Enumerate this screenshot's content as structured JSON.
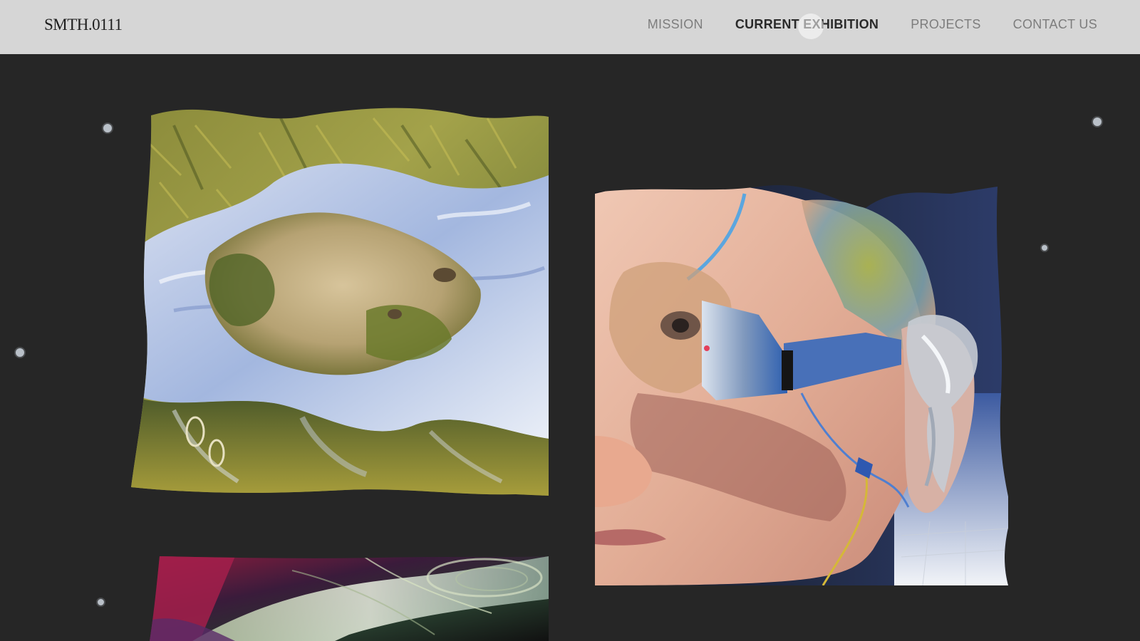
{
  "site": {
    "logo": "SMTH.0111"
  },
  "nav": {
    "items": [
      {
        "label": "MISSION",
        "active": false
      },
      {
        "label": "CURRENT EXHIBITION",
        "active": true
      },
      {
        "label": "PROJECTS",
        "active": false
      },
      {
        "label": "CONTACT US",
        "active": false
      }
    ]
  },
  "colors": {
    "header_bg": "#d6d6d6",
    "page_bg": "#262626",
    "nav_text": "#7d7d7d",
    "nav_active": "#2a2a2a"
  },
  "gallery": {
    "artworks": [
      {
        "name": "grass-water-artwork"
      },
      {
        "name": "face-goggles-artwork"
      },
      {
        "name": "abstract-texture-artwork"
      }
    ]
  }
}
